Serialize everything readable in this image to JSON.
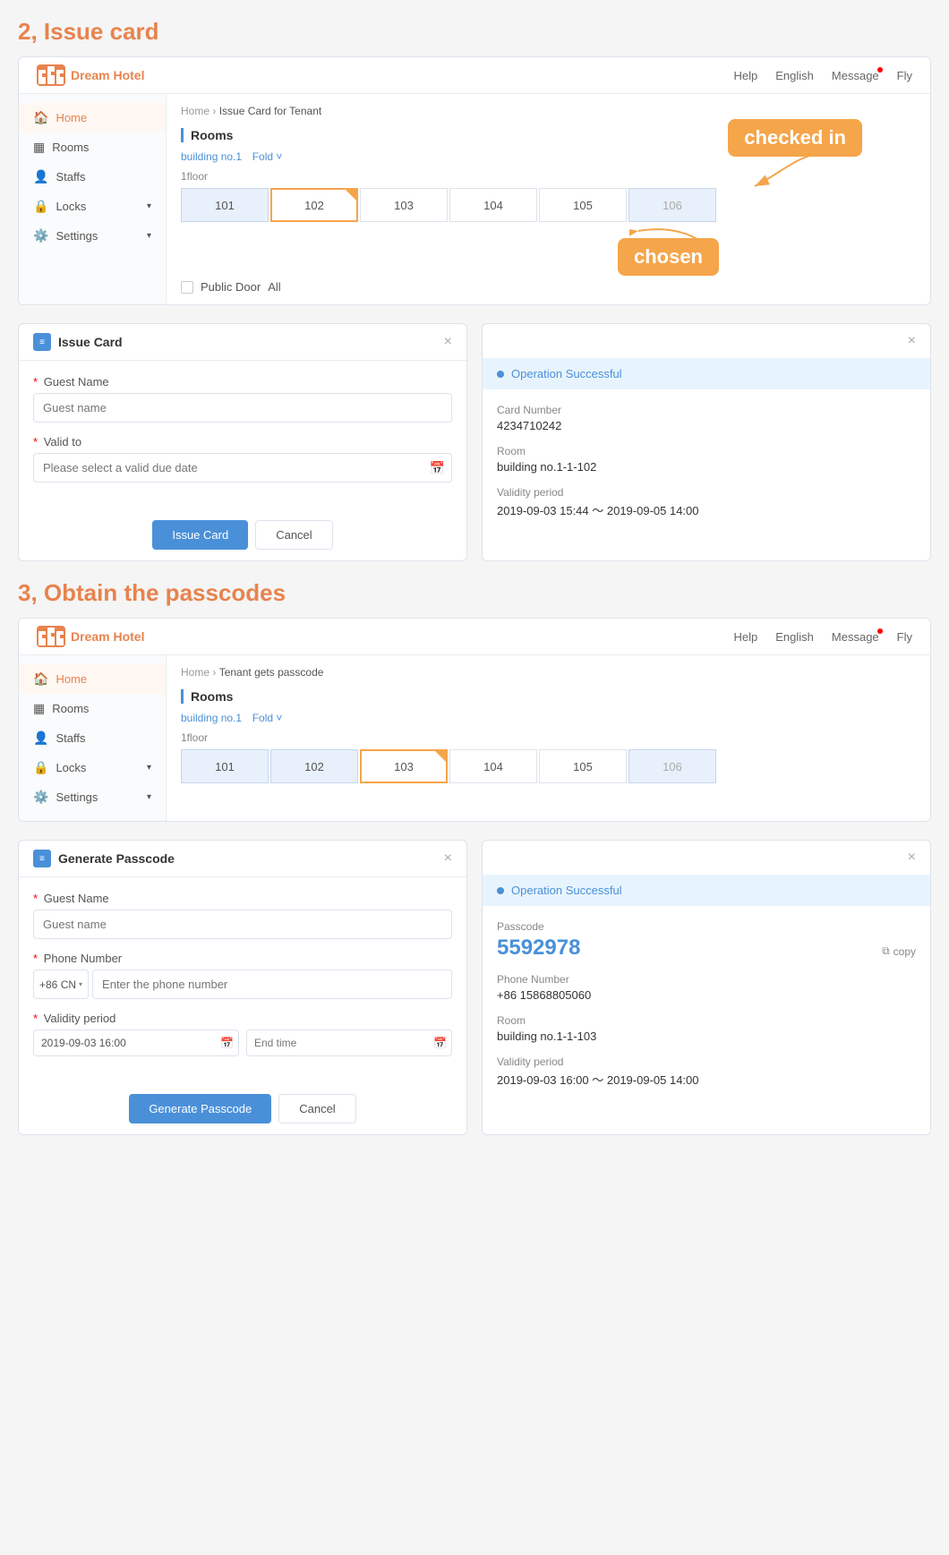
{
  "section1": {
    "title": "2, Issue card",
    "browser": {
      "logo": "HoHeI",
      "brand": "Dream Hotel",
      "nav": [
        "Help",
        "English",
        "Message",
        "Fly"
      ],
      "breadcrumb": [
        "Home",
        "Issue Card for Tenant"
      ],
      "sidebar": [
        {
          "label": "Home",
          "icon": "🏠",
          "active": true
        },
        {
          "label": "Rooms",
          "icon": "▦"
        },
        {
          "label": "Staffs",
          "icon": "👤"
        },
        {
          "label": "Locks",
          "icon": "🔒",
          "arrow": true
        },
        {
          "label": "Settings",
          "icon": "⚙️",
          "arrow": true
        }
      ],
      "rooms_section": "Rooms",
      "building": "building no.1",
      "fold": "Fold ˅",
      "floor": "1floor",
      "rooms": [
        "101",
        "102",
        "103",
        "104",
        "105",
        "106"
      ],
      "public_door": "Public Door",
      "all": "All",
      "checked_in_label": "checked in",
      "chosen_label": "chosen"
    }
  },
  "dialog_issue_card": {
    "title": "Issue Card",
    "close": "×",
    "guest_name_label": "Guest Name",
    "guest_name_placeholder": "Guest name",
    "valid_to_label": "Valid to",
    "valid_to_placeholder": "Please select a valid due date",
    "issue_card_btn": "Issue Card",
    "cancel_btn": "Cancel"
  },
  "dialog_success_issue": {
    "close": "×",
    "success_text": "Operation Successful",
    "card_number_label": "Card Number",
    "card_number_value": "4234710242",
    "room_label": "Room",
    "room_value": "building no.1-1-102",
    "validity_label": "Validity period",
    "validity_value": "2019-09-03 15:44 ～ 2019-09-05 14:00"
  },
  "section2": {
    "title": "3, Obtain the passcodes",
    "browser": {
      "logo": "HoHeI",
      "brand": "Dream Hotel",
      "nav": [
        "Help",
        "English",
        "Message",
        "Fly"
      ],
      "breadcrumb": [
        "Home",
        "Tenant gets passcode"
      ],
      "sidebar": [
        {
          "label": "Home",
          "icon": "🏠",
          "active": true
        },
        {
          "label": "Rooms",
          "icon": "▦"
        },
        {
          "label": "Staffs",
          "icon": "👤"
        },
        {
          "label": "Locks",
          "icon": "🔒",
          "arrow": true
        },
        {
          "label": "Settings",
          "icon": "⚙️",
          "arrow": true
        }
      ],
      "rooms_section": "Rooms",
      "building": "building no.1",
      "fold": "Fold ˅",
      "floor": "1floor",
      "rooms": [
        "101",
        "102",
        "103",
        "104",
        "105",
        "106"
      ]
    }
  },
  "dialog_generate_passcode": {
    "title": "Generate Passcode",
    "close": "×",
    "guest_name_label": "Guest Name",
    "guest_name_placeholder": "Guest name",
    "phone_label": "Phone Number",
    "phone_prefix": "+86 CN",
    "phone_placeholder": "Enter the phone number",
    "validity_label": "Validity period",
    "start_value": "2019-09-03 16:00",
    "end_placeholder": "End time",
    "generate_btn": "Generate Passcode",
    "cancel_btn": "Cancel"
  },
  "dialog_success_passcode": {
    "close": "×",
    "success_text": "Operation Successful",
    "passcode_label": "Passcode",
    "passcode_value": "5592978",
    "copy_label": "copy",
    "phone_label": "Phone Number",
    "phone_value": "+86 15868805060",
    "room_label": "Room",
    "room_value": "building no.1-1-103",
    "validity_label": "Validity period",
    "validity_value": "2019-09-03 16:00 ～ 2019-09-05 14:00"
  }
}
